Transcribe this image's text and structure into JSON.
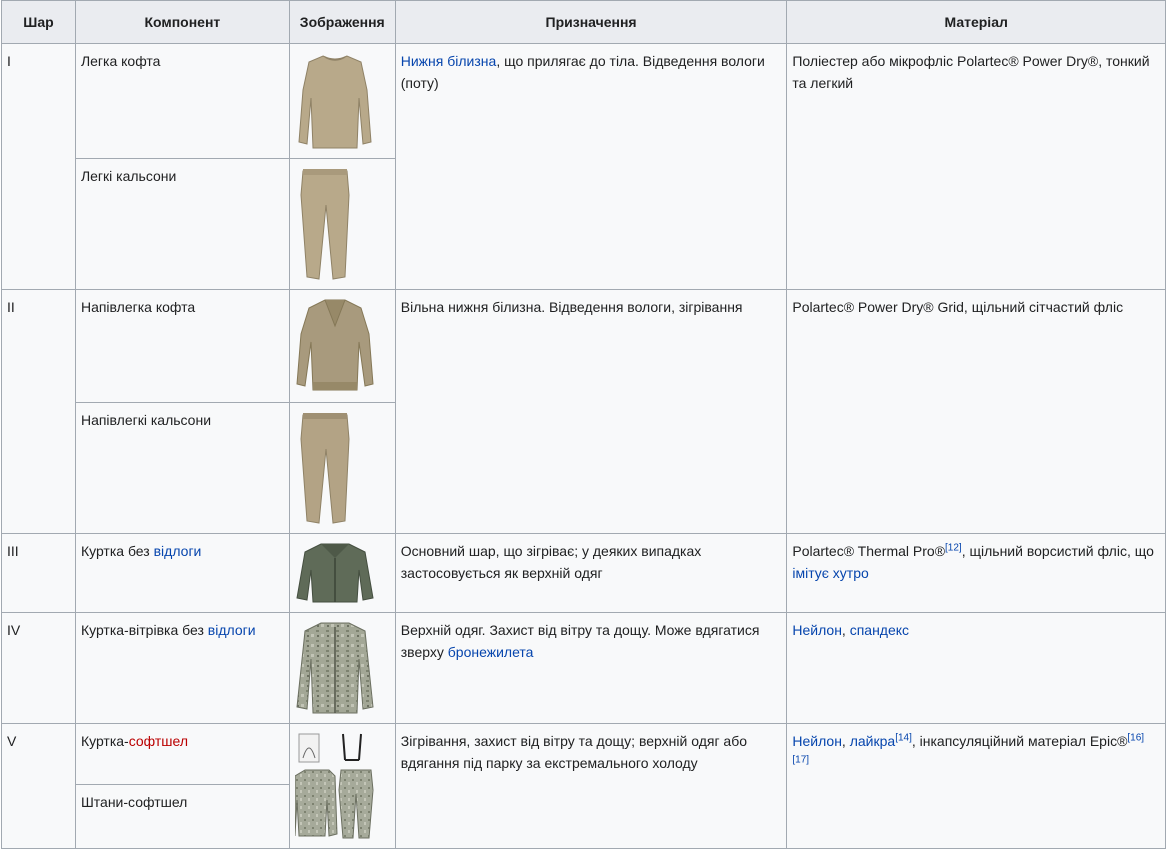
{
  "headers": {
    "layer": "Шар",
    "component": "Компонент",
    "image": "Зображення",
    "purpose": "Призначення",
    "material": "Матеріал"
  },
  "rows": [
    {
      "layer": "I",
      "c1": "Легка кофта",
      "c2": "Легкі кальсони",
      "purpose_link": "Нижня білизна",
      "purpose_rest": ", що прилягає до тіла. Відведення вологи (поту)",
      "material": "Поліестер або мікрофліс Polartec® Power Dry®, тонкий та легкий"
    },
    {
      "layer": "II",
      "c1": "Напівлегка кофта",
      "c2": "Напівлегкі кальсони",
      "purpose": "Вільна нижня білизна. Відведення вологи, зігрівання",
      "material": "Polartec® Power Dry® Grid, щільний сітчастий фліс"
    },
    {
      "layer": "III",
      "c_text": "Куртка без ",
      "c_link": "відлоги",
      "purpose": "Основний шар, що зігріває; у деяких випадках застосовується як верхній одяг",
      "m_text1": "Polartec® Thermal Pro®",
      "m_ref1": "[12]",
      "m_text2": ", щільний ворсистий фліс, що ",
      "m_link": "імітує хутро"
    },
    {
      "layer": "IV",
      "c_text": "Куртка-вітрівка без ",
      "c_link": "відлоги",
      "p_text": "Верхній одяг. Захист від вітру та дощу. Може вдягатися зверху ",
      "p_link": "бронежилета",
      "m_link1": "Нейлон",
      "m_sep": ", ",
      "m_link2": "спандекс"
    },
    {
      "layer": "V",
      "c1_text": "Куртка-",
      "c1_link": "софтшел",
      "c2": "Штани-софтшел",
      "purpose": "Зігрівання, захист від вітру та дощу; верхній одяг або вдягання під парку за екстремального холоду",
      "m_link1": "Нейлон",
      "m_sep": ", ",
      "m_link2": "лайкра",
      "m_ref1": "[14]",
      "m_text1": ", інкапсуляційний матеріал Epic®",
      "m_ref2": "[16]",
      "m_ref3": "[17]"
    }
  ],
  "colors": {
    "link": "#0645ad",
    "redlink": "#ba0000",
    "header_bg": "#eaecf0",
    "cell_bg": "#f8f9fa",
    "border": "#a2a9b1",
    "tan_garment": "#b8a98a",
    "fleece_green": "#5f6b58",
    "acu_camo": "#a3a796"
  },
  "images": [
    "light-shirt-image",
    "light-drawers-image",
    "midweight-shirt-image",
    "midweight-drawers-image",
    "fleece-jacket-image",
    "wind-jacket-image",
    "softshell-image"
  ]
}
